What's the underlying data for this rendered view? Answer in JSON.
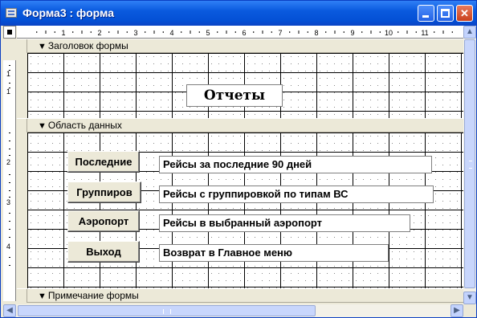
{
  "window": {
    "title": "Форма3 : форма"
  },
  "ruler": {
    "h_numbers": [
      "1",
      "2",
      "3",
      "4",
      "5",
      "6",
      "7",
      "8",
      "9",
      "10",
      "11"
    ],
    "v_numbers": [
      "1",
      "1",
      "2",
      "3",
      "4"
    ]
  },
  "sections": {
    "header": "Заголовок формы",
    "detail": "Область данных",
    "footer": "Примечание формы"
  },
  "form": {
    "title_label": "Отчеты",
    "buttons": [
      {
        "label": "Последние",
        "desc": "Рейсы за последние 90 дней"
      },
      {
        "label": "Группиров",
        "desc": "Рейсы с группировкой по типам ВС"
      },
      {
        "label": "Аэропорт",
        "desc": "Рейсы в выбранный аэропорт"
      },
      {
        "label": "Выход",
        "desc": "Возврат в Главное меню"
      }
    ]
  },
  "icons": {
    "window_icon": "form-window-icon",
    "section_arrow": "arrow-down-icon",
    "scroll_up": "arrow-up-icon",
    "scroll_down": "arrow-down-icon",
    "scroll_left": "arrow-left-icon",
    "scroll_right": "arrow-right-icon"
  },
  "colors": {
    "titlebar": "#0a5ade",
    "close_button": "#c9401d",
    "canvas": "#ece9d8"
  }
}
